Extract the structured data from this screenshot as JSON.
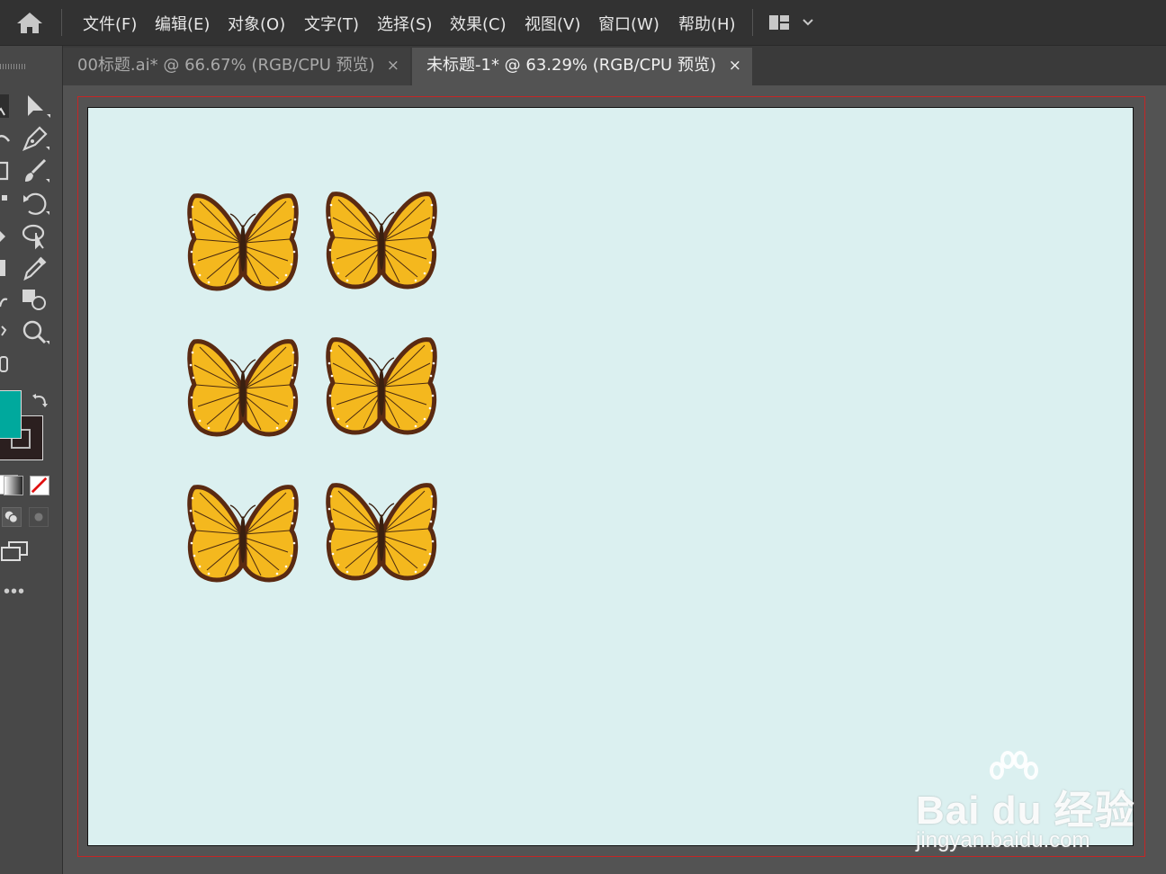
{
  "menubar": {
    "items": [
      "文件(F)",
      "编辑(E)",
      "对象(O)",
      "文字(T)",
      "选择(S)",
      "效果(C)",
      "视图(V)",
      "窗口(W)",
      "帮助(H)"
    ]
  },
  "tabs": [
    {
      "label": "00标题.ai* @ 66.67% (RGB/CPU 预览)",
      "close": "×",
      "active": false
    },
    {
      "label": "未标题-1* @ 63.29% (RGB/CPU 预览)",
      "close": "×",
      "active": true
    }
  ],
  "tools": {
    "icons": [
      "selection-icon",
      "direct-selection-icon",
      "pen-icon",
      "curvature-icon",
      "rectangle-icon",
      "paintbrush-icon",
      "shaper-icon",
      "rotate-icon",
      "eraser-icon",
      "puppet-warp-icon",
      "width-icon",
      "eyedropper-icon",
      "free-transform-icon",
      "shape-builder-icon",
      "artboard-icon",
      "zoom-icon"
    ],
    "more": "•••"
  },
  "colors": {
    "fill": "#00a99d",
    "stroke": "#2b1f1f",
    "artboard_bg": "#dbf0f0",
    "butterfly_wing": "#f4b81e",
    "butterfly_edge": "#5a2a12",
    "bleed_guide": "#c42626"
  },
  "artboard": {
    "butterfly_count": 6
  },
  "watermark": {
    "main": "Bai du 经验",
    "sub": "jingyan.baidu.com"
  }
}
